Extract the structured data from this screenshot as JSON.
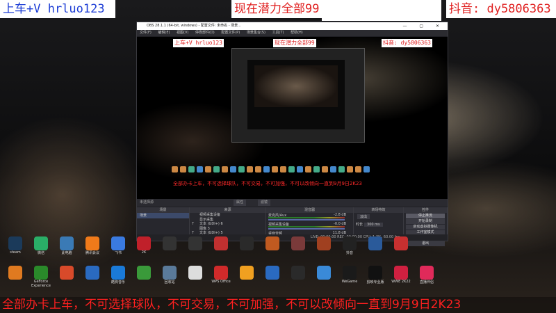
{
  "banners": {
    "left": "上车+V hrluo123",
    "middle": "现在潜力全部99",
    "right": "抖音: dy5806363"
  },
  "obs": {
    "window_title": "OBS 28.1.1 (64-bit, windows) - 配置文件: 未命名 - 场景...",
    "menu": [
      "文件(F)",
      "编辑(E)",
      "视图(V)",
      "停靠部件(D)",
      "配置文件(P)",
      "场景集合(S)",
      "工具(T)",
      "帮助(H)"
    ],
    "nested": {
      "left": "上车+V hrluo123",
      "middle": "现在潜力全部99",
      "right": "抖音: dy5806363"
    },
    "preview_caption": "全部办卡上车，不可选择球队，不可交易，不可加强，不可以改倾向一直到9月9日2K23",
    "no_source_selected": "未选择源",
    "tb_properties": "属性",
    "tb_filters": "滤镜",
    "docks": {
      "scenes": {
        "header": "场景",
        "items": [
          "场景"
        ]
      },
      "sources": {
        "header": "来源",
        "items": [
          {
            "type": "",
            "label": "视频采集设备"
          },
          {
            "type": "",
            "label": "显示采集"
          },
          {
            "type": "T",
            "label": "文本 (GDI+) 6"
          },
          {
            "type": "",
            "label": "图像 3"
          },
          {
            "type": "T",
            "label": "文本 (GDI+) 5"
          },
          {
            "type": "",
            "label": "图像"
          }
        ]
      },
      "mixer": {
        "header": "混音器",
        "channels": [
          {
            "name": "麦克风/Aux",
            "db": "-2.8 dB"
          },
          {
            "name": "视频采集设备",
            "db": "-0.0 dB"
          },
          {
            "name": "桌面音频",
            "db": "11.8 dB"
          }
        ]
      },
      "transitions": {
        "header": "转场特效",
        "type": "淡出",
        "duration_label": "时长",
        "duration": "300 ms"
      },
      "controls": {
        "header": "控件",
        "buttons": [
          "停止推流",
          "开始录制",
          "启动虚拟摄像机",
          "工作室模式",
          "设置",
          "退出"
        ]
      }
    },
    "status": "LIVE: 00:00:00   REC: 00:00:00   CPU: 1.3%, 60.00 fps"
  },
  "desktop_row1": [
    {
      "label": "steam",
      "color": "#1b3a5a"
    },
    {
      "label": "微信",
      "color": "#2aae67"
    },
    {
      "label": "此电脑",
      "color": "#3a7ab5"
    },
    {
      "label": "腾讯会议",
      "color": "#f07a1a"
    },
    {
      "label": "飞书",
      "color": "#3a7ae0"
    },
    {
      "label": "2K",
      "color": "#c0202a"
    },
    {
      "label": "",
      "color": "#333333"
    },
    {
      "label": "",
      "color": "#333333"
    },
    {
      "label": "",
      "color": "#c03030"
    },
    {
      "label": "",
      "color": "#2a2a2a"
    },
    {
      "label": "",
      "color": "#c05a20"
    },
    {
      "label": "",
      "color": "#7a3a3a"
    },
    {
      "label": "",
      "color": "#a04020"
    },
    {
      "label": "抖音",
      "color": "#222222"
    },
    {
      "label": "",
      "color": "#2a5a9a"
    },
    {
      "label": "",
      "color": "#c83030"
    }
  ],
  "desktop_row2": [
    {
      "label": "",
      "color": "#e07a20"
    },
    {
      "label": "GeForce Experience",
      "color": "#2a8a2a"
    },
    {
      "label": "",
      "color": "#d84a2a"
    },
    {
      "label": "",
      "color": "#2a6ac0"
    },
    {
      "label": "酷狗音乐",
      "color": "#1a7ad8"
    },
    {
      "label": "",
      "color": "#3a9a3a"
    },
    {
      "label": "回收站",
      "color": "#5a7a9a"
    },
    {
      "label": "",
      "color": "#dddddd"
    },
    {
      "label": "WPS Office",
      "color": "#d02a2a"
    },
    {
      "label": "",
      "color": "#f0a020"
    },
    {
      "label": "",
      "color": "#2a6ac0"
    },
    {
      "label": "",
      "color": "#2a2a2a"
    },
    {
      "label": "",
      "color": "#3a8ad8"
    },
    {
      "label": "WeGame",
      "color": "#1a1a1a"
    },
    {
      "label": "剪映专业版",
      "color": "#111111"
    },
    {
      "label": "WWE 2K22",
      "color": "#d02040"
    },
    {
      "label": "直播伴侣",
      "color": "#e02a5a"
    }
  ],
  "bottom_caption": "全部办卡上车，不可选择球队，不可交易，不可加强，不可以改倾向一直到9月9日2K23"
}
